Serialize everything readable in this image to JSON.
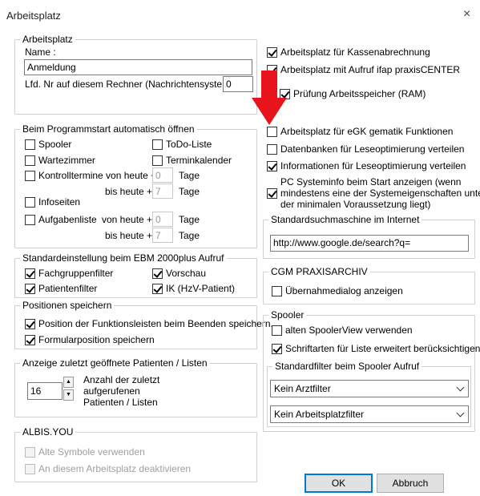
{
  "window": {
    "title": "Arbeitsplatz",
    "close_glyph": "×"
  },
  "arbeitsplatz": {
    "legend": "Arbeitsplatz",
    "name_label": "Name :",
    "name_value": "Anmeldung",
    "lfd_label": "Lfd. Nr auf diesem Rechner (Nachrichtensystem):",
    "lfd_value": "0"
  },
  "right_top": {
    "kassen": {
      "label": "Arbeitsplatz für Kassenabrechnung",
      "checked": true
    },
    "praxis": {
      "label": "Arbeitsplatz mit Aufruf ifap praxisCENTER",
      "checked": true
    },
    "ram": {
      "label": "Prüfung Arbeitsspeicher (RAM)",
      "checked": true
    },
    "egk": {
      "label": "Arbeitsplatz für eGK gematik Funktionen",
      "checked": false
    },
    "db": {
      "label": "Datenbanken für Leseoptimierung verteilen",
      "checked": false
    },
    "info": {
      "label": "Informationen für Leseoptimierung verteilen",
      "checked": true
    },
    "sysinfo": {
      "line1": "PC Systeminfo beim Start anzeigen (wenn",
      "line2": "mindestens eine der Systemeigenschaften unter",
      "line3": "der minimalen Voraussetzung liegt)",
      "checked": true
    }
  },
  "programmstart": {
    "legend": "Beim Programmstart automatisch öffnen",
    "spooler": {
      "label": "Spooler",
      "checked": false
    },
    "todo": {
      "label": "ToDo-Liste",
      "checked": false
    },
    "wartezimmer": {
      "label": "Wartezimmer",
      "checked": false
    },
    "terminkalender": {
      "label": "Terminkalender",
      "checked": false
    },
    "kontroll": {
      "label": "Kontrolltermine von heute +",
      "checked": false,
      "value": "0",
      "unit": "Tage"
    },
    "bis1": {
      "label": "bis heute +",
      "value": "7",
      "unit": "Tage"
    },
    "infoseiten": {
      "label": "Infoseiten",
      "checked": false
    },
    "aufgaben": {
      "label": "Aufgabenliste",
      "checked": false,
      "von_label": "von heute +",
      "value": "0",
      "unit": "Tage"
    },
    "bis2": {
      "label": "bis heute +",
      "value": "7",
      "unit": "Tage"
    }
  },
  "ebm": {
    "legend": "Standardeinstellung beim EBM 2000plus Aufruf",
    "fachgruppen": {
      "label": "Fachgruppenfilter",
      "checked": true
    },
    "vorschau": {
      "label": "Vorschau",
      "checked": true
    },
    "patienten": {
      "label": "Patientenfilter",
      "checked": true
    },
    "ik": {
      "label": "IK (HzV-Patient)",
      "checked": true
    }
  },
  "positionen": {
    "legend": "Positionen speichern",
    "funktionsleisten": {
      "label": "Position der Funktionsleisten beim Beenden speichern.",
      "checked": true
    },
    "formular": {
      "label": "Formularposition speichern",
      "checked": true
    }
  },
  "anzeige": {
    "legend": "Anzeige zuletzt geöffnete Patienten / Listen",
    "value": "16",
    "line1": "Anzahl der zuletzt",
    "line2": "aufgerufenen",
    "line3": "Patienten / Listen",
    "spin_up": "▲",
    "spin_down": "▼"
  },
  "albis": {
    "legend": "ALBIS.YOU",
    "alte": {
      "label": "Alte Symbole verwenden",
      "checked": false
    },
    "deaktivieren": {
      "label": "An diesem Arbeitsplatz deaktivieren",
      "checked": false
    }
  },
  "suchmaschine": {
    "legend": "Standardsuchmaschine im Internet",
    "value": "http://www.google.de/search?q="
  },
  "cgm": {
    "legend": "CGM PRAXISARCHIV",
    "uebernahme": {
      "label": "Übernahmedialog anzeigen",
      "checked": false
    }
  },
  "spooler": {
    "legend": "Spooler",
    "alten": {
      "label": "alten SpoolerView verwenden",
      "checked": false
    },
    "schrift": {
      "label": "Schriftarten für Liste erweitert berücksichtigen",
      "checked": true
    },
    "filter_legend": "Standardfilter beim Spooler Aufruf",
    "arztfilter": "Kein Arztfilter",
    "arbeitsplatzfilter": "Kein Arbeitsplatzfilter"
  },
  "buttons": {
    "ok": "OK",
    "abbruch": "Abbruch"
  },
  "colors": {
    "arrow": "#e8141b",
    "default_button": "#0078d7"
  },
  "icons": {
    "arrow": "red-arrow-down-icon"
  }
}
